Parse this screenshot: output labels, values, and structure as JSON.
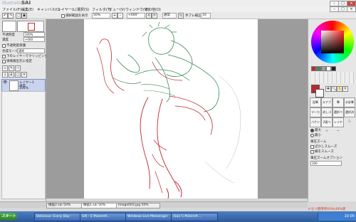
{
  "titlebar": {
    "logo": "Illustration",
    "app_name": "SAI"
  },
  "menu": [
    "ファイル(F)",
    "編集(E)",
    "キャンバス(C)",
    "レイヤー(L)",
    "選択(S)",
    "フィルタ(T)",
    "ビュー(V)",
    "ウィンドウ(W)",
    "その他(O)"
  ],
  "toolbar": {
    "show_selection": "選択範囲を表示",
    "zoom": "50%",
    "angle": "+000°",
    "mode": "通常",
    "stabilizer_label": "手ブレ補正",
    "stabilizer": "10"
  },
  "layer_panel": {
    "opacity_label": "不透明度",
    "opacity": "100%",
    "density_label": "濃度",
    "density": "+000",
    "protect_label": "不透明度保護",
    "mode_label": "合成モード",
    "mode": "通常",
    "clip_label": "下のレイヤーでクリッピング",
    "ref_label": "領域検出元に指定",
    "layer_name": "レイヤー1",
    "layer_mode": "通常",
    "layer_opacity": "100%"
  },
  "tools": [
    "鉛筆",
    "エアブラシ",
    "筆",
    "水彩筆",
    "マーカー",
    "消しゴム",
    "選択ペン",
    "選択消し",
    "バケツ",
    "2値ペン",
    "レイヤー"
  ],
  "brush_opts": {
    "size_label": "最大",
    "size_opt": "最小",
    "edge_label": "筆圧ズーム",
    "pressure1": "ぼかしスムーズ",
    "pressure2": "縁をスムーズ",
    "density_label": "筆圧ズームオプション",
    "density": "100"
  },
  "doc_tabs": [
    {
      "name": "線画2.sai",
      "zoom": "50%"
    },
    {
      "name": "線画1.sai",
      "zoom": "50%"
    },
    {
      "name": "Image003.jpg",
      "zoom": "50%"
    }
  ],
  "status": "メモリ使用率93%(49%使用)CPU使用率 0%",
  "taskbar": {
    "start": "スタート",
    "tasks": [
      "Delicious: Every Day -",
      "SAI - C:¥Users¥...",
      "Windows Live Messenger",
      "(Sai) C:¥Users¥..."
    ],
    "clock": "10:00"
  },
  "colors": {
    "accent_red": "#c0262c",
    "paper": "#ffffff"
  }
}
